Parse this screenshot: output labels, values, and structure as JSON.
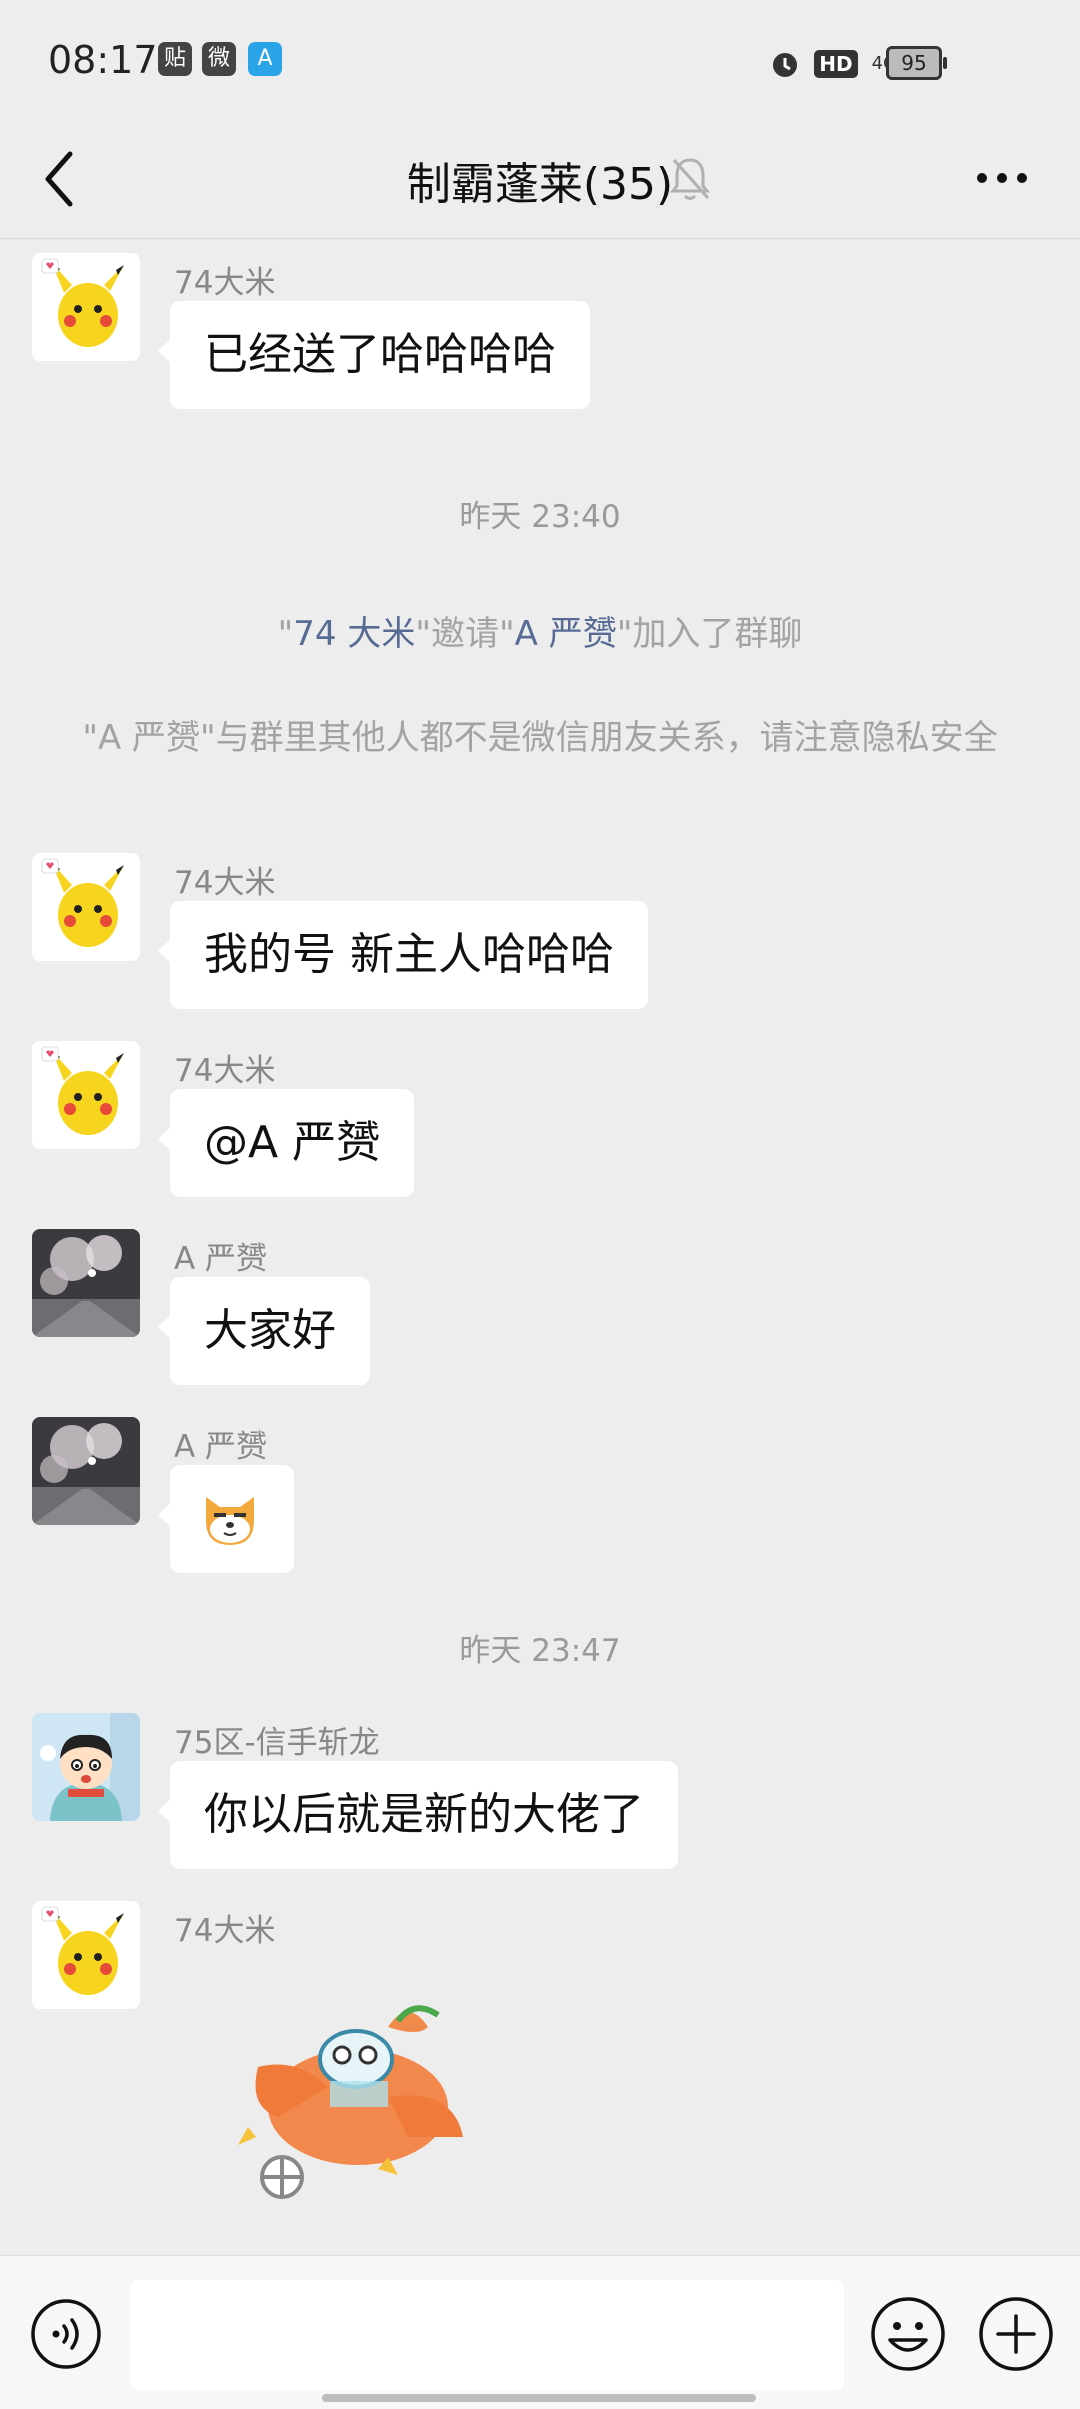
{
  "status_bar": {
    "time": "08:17",
    "notifications": [
      "贴",
      "微",
      "A"
    ],
    "hd": "HD",
    "network": "4G",
    "battery": "95"
  },
  "header": {
    "title": "制霸蓬莱(35)"
  },
  "messages": [
    {
      "sender": "74大米",
      "text": "已经送了哈哈哈哈"
    },
    {
      "timestamp": "昨天 23:40"
    },
    {
      "system_invite": {
        "q1": "\"",
        "name1": "74 大米",
        "mid": "\"邀请\"",
        "name2": "A 严赟",
        "end": "\"加入了群聊"
      }
    },
    {
      "system_notice": "\"A 严赟\"与群里其他人都不是微信朋友关系，请注意隐私安全"
    },
    {
      "sender": "74大米",
      "text": "我的号 新主人哈哈哈"
    },
    {
      "sender": "74大米",
      "text": "@A 严赟"
    },
    {
      "sender": "A 严赟",
      "text": "大家好"
    },
    {
      "sender": "A 严赟",
      "sticker": "dog-emoji"
    },
    {
      "timestamp": "昨天 23:47"
    },
    {
      "sender": "75区-信手斩龙",
      "text": "你以后就是新的大佬了"
    },
    {
      "sender": "74大米",
      "sticker": "airplane-sticker"
    }
  ],
  "icons": {
    "back": "chevron-left-icon",
    "mute": "bell-off-icon",
    "more": "more-dots-icon",
    "voice": "voice-icon",
    "emoji": "emoji-icon",
    "plus": "plus-icon"
  },
  "input": {
    "placeholder": ""
  }
}
